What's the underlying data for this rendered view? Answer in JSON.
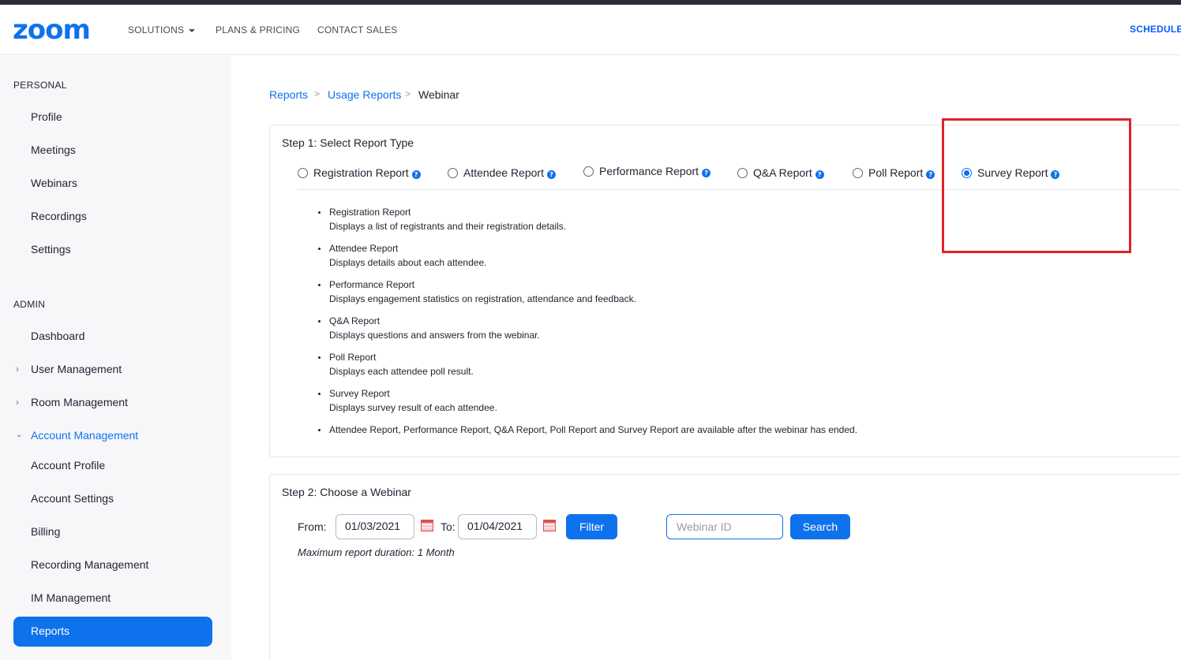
{
  "header": {
    "logo": "zoom",
    "nav": [
      {
        "label": "SOLUTIONS",
        "has_caret": true
      },
      {
        "label": "PLANS & PRICING"
      },
      {
        "label": "CONTACT SALES"
      }
    ],
    "schedule": "SCHEDULE"
  },
  "sidebar": {
    "personal_title": "PERSONAL",
    "personal_items": [
      "Profile",
      "Meetings",
      "Webinars",
      "Recordings",
      "Settings"
    ],
    "admin_title": "ADMIN",
    "admin_items": {
      "dashboard": "Dashboard",
      "user_management": "User Management",
      "room_management": "Room Management",
      "account_management": "Account Management",
      "account_profile": "Account Profile",
      "account_settings": "Account Settings",
      "billing": "Billing",
      "recording_management": "Recording Management",
      "im_management": "IM Management",
      "reports": "Reports"
    }
  },
  "breadcrumb": {
    "reports": "Reports",
    "usage_reports": "Usage Reports",
    "current": "Webinar",
    "separator": ">"
  },
  "step1": {
    "title": "Step 1: Select Report Type",
    "options": [
      {
        "label": "Registration Report",
        "checked": false
      },
      {
        "label": "Attendee Report",
        "checked": false
      },
      {
        "label": "Performance Report",
        "checked": false
      },
      {
        "label": "Q&A Report",
        "checked": false
      },
      {
        "label": "Poll Report",
        "checked": false
      },
      {
        "label": "Survey Report",
        "checked": true
      }
    ],
    "descriptions": [
      {
        "title": "Registration Report",
        "text": "Displays a list of registrants and their registration details."
      },
      {
        "title": "Attendee Report",
        "text": "Displays details about each attendee."
      },
      {
        "title": "Performance Report",
        "text": "Displays engagement statistics on registration, attendance and feedback."
      },
      {
        "title": "Q&A Report",
        "text": "Displays questions and answers from the webinar."
      },
      {
        "title": "Poll Report",
        "text": "Displays each attendee poll result."
      },
      {
        "title": "Survey Report",
        "text": "Displays survey result of each attendee."
      }
    ],
    "note": "Attendee Report, Performance Report, Q&A Report, Poll Report and Survey Report are available after the webinar has ended."
  },
  "step2": {
    "title": "Step 2: Choose a Webinar",
    "from_label": "From:",
    "from_value": "01/03/2021",
    "to_label": "To:",
    "to_value": "01/04/2021",
    "filter_label": "Filter",
    "webinar_id_placeholder": "Webinar ID",
    "search_label": "Search",
    "max_duration": "Maximum report duration: 1 Month"
  },
  "colors": {
    "brand": "#0e72ed",
    "highlight_box": "#e0222a"
  }
}
